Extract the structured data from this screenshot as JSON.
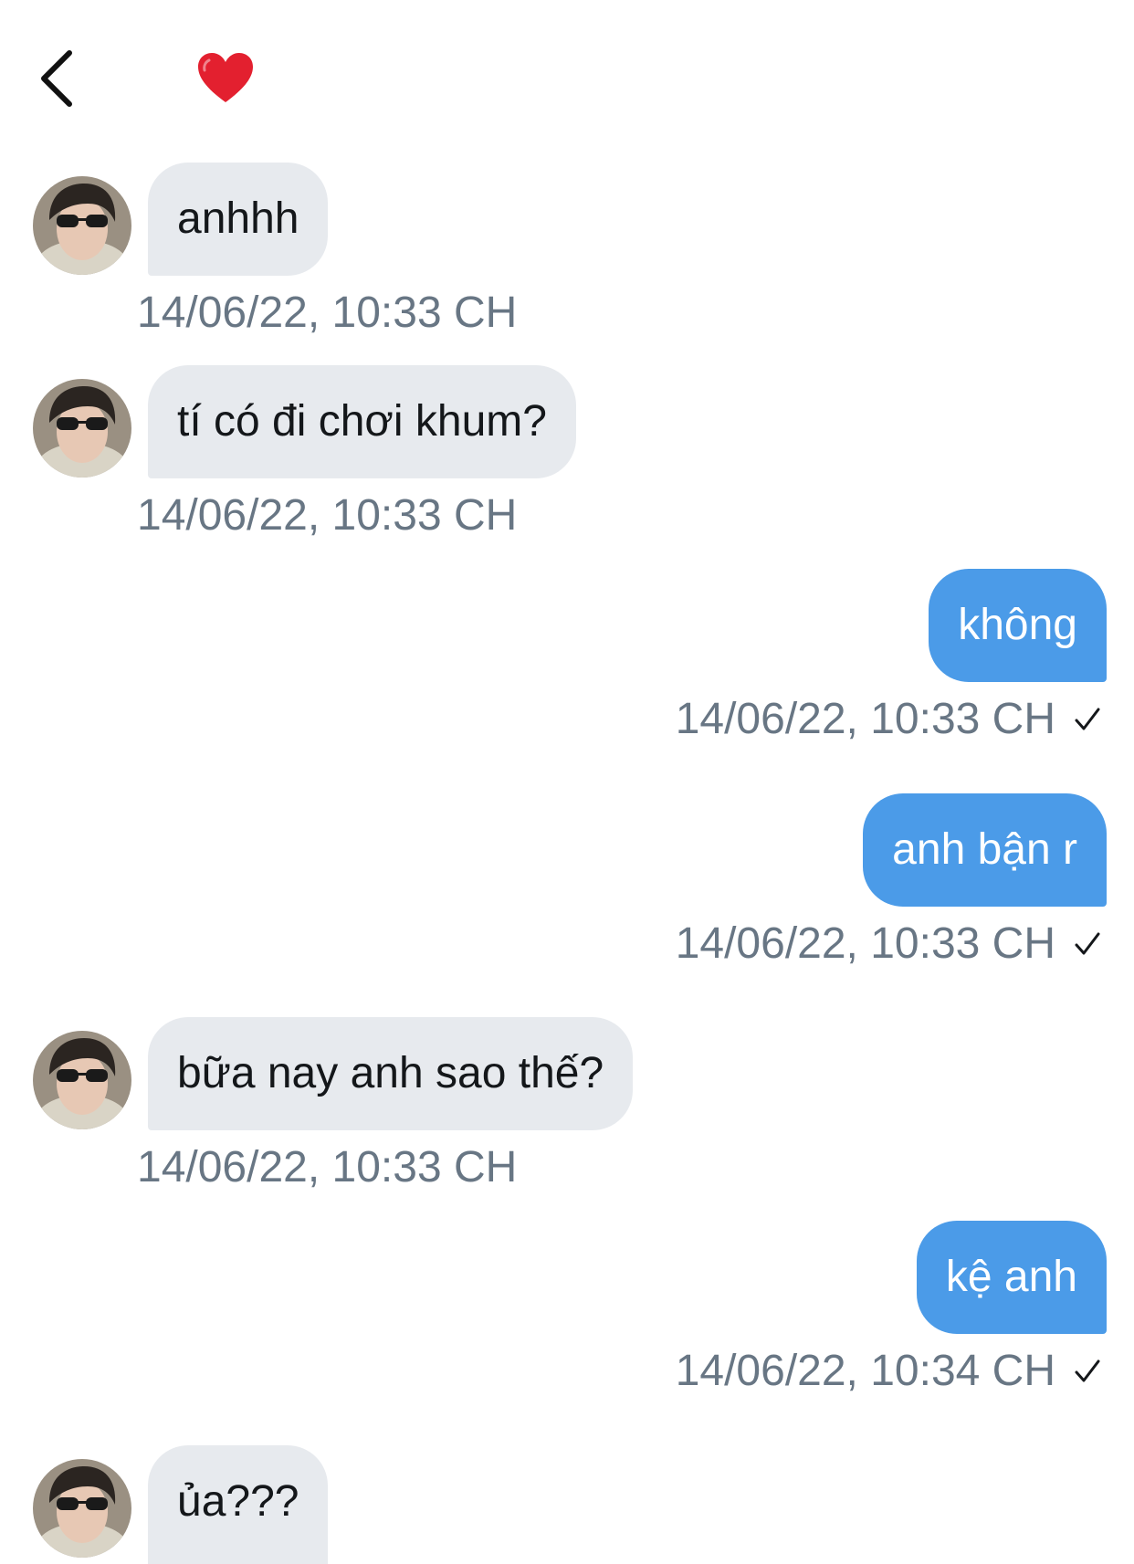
{
  "header": {
    "back_icon": "chevron-left-icon",
    "emoji": "heart-emoji",
    "heart_color": "#e3202f"
  },
  "colors": {
    "incoming_bubble": "#e7eaee",
    "outgoing_bubble": "#4b9be8",
    "timestamp": "#687684"
  },
  "messages": [
    {
      "direction": "incoming",
      "text": "anhhh",
      "timestamp": "14/06/22, 10:33 CH"
    },
    {
      "direction": "incoming",
      "text": "tí có đi chơi khum?",
      "timestamp": "14/06/22, 10:33 CH"
    },
    {
      "direction": "outgoing",
      "text": "không",
      "timestamp": "14/06/22, 10:33 CH",
      "sent_icon": "checkmark-icon"
    },
    {
      "direction": "outgoing",
      "text": "anh bận r",
      "timestamp": "14/06/22, 10:33 CH",
      "sent_icon": "checkmark-icon"
    },
    {
      "direction": "incoming",
      "text": "bữa nay anh sao thế?",
      "timestamp": "14/06/22, 10:33 CH"
    },
    {
      "direction": "outgoing",
      "text": "kệ anh",
      "timestamp": "14/06/22, 10:34 CH",
      "sent_icon": "checkmark-icon"
    },
    {
      "direction": "incoming",
      "text": "ủa???"
    }
  ]
}
